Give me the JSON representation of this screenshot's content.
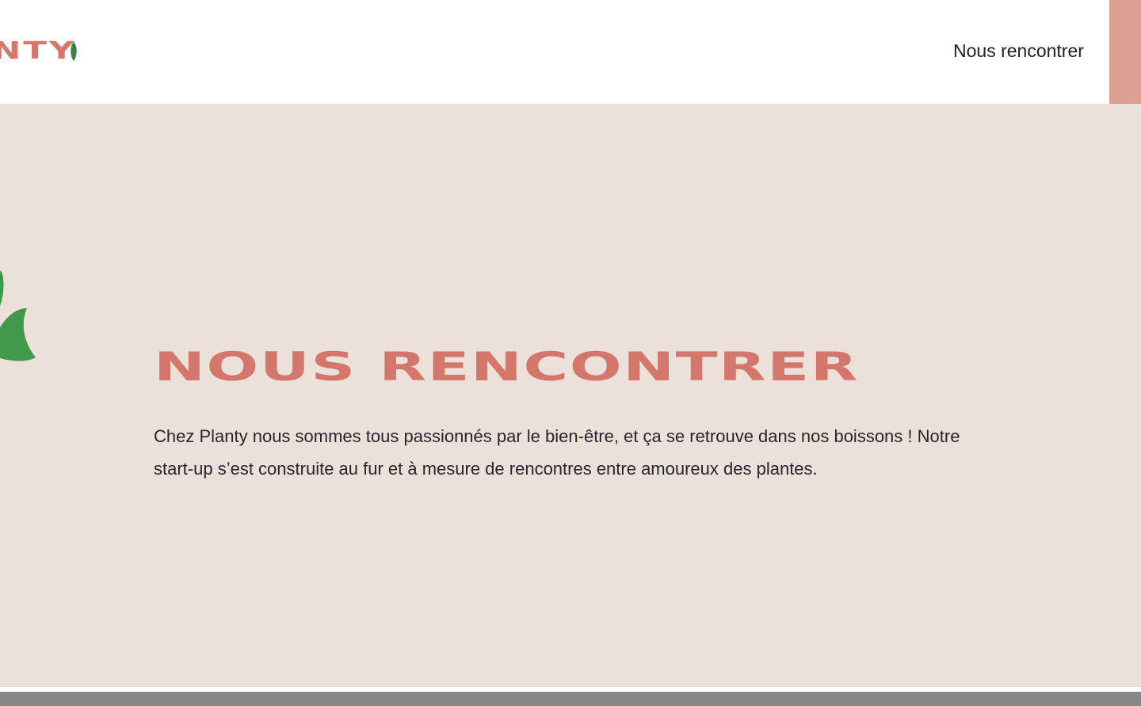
{
  "header": {
    "logo_text": "NTY",
    "nav_link_label": "Nous rencontrer"
  },
  "hero": {
    "title": "NOUS RENCONTRER",
    "paragraph": "Chez Planty nous sommes tous passionnés par le bien-être, et ça se retrouve dans nos boissons ! Notre start-up s’est construite au fur et à mesure de rencontres entre amoureux des plantes."
  },
  "colors": {
    "brand": "#d8766b",
    "accent": "#dd9e92",
    "hero_background": "#ebe1d9",
    "leaf_green": "#3f9a4c",
    "text_dark": "#26262e"
  },
  "icons": {
    "logo_leaf": "leaf-icon",
    "hero_plant": "plant-icon"
  }
}
